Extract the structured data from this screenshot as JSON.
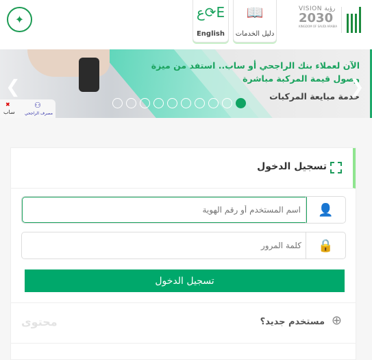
{
  "header": {
    "english_label": "English",
    "guide_label": "دليل الخدمات",
    "vision": {
      "line1": "VISION رؤية",
      "line2": "2030",
      "line3": "KINGDOM OF SAUDI ARABIA"
    },
    "logo": "أبشر"
  },
  "banner": {
    "line1": "الآن لعملاء بنك الراجحي أو ساب.. استفد من ميزة",
    "line2": "وصول قيمة المركبة مباشرة",
    "title": "خدمة مبايعة المركبات",
    "slide_count": 10,
    "active_slide": 1,
    "partners": [
      "ساب",
      "مصرف الراجحي"
    ]
  },
  "login": {
    "title": "تسجيل الدخول",
    "username_placeholder": "اسم المستخدم أو رقم الهوية",
    "password_placeholder": "كلمة المرور",
    "submit_label": "تسجيل الدخول",
    "new_user_label": "مستخدم جديد؟",
    "watermark": "محتوى"
  },
  "colors": {
    "accent": "#00a86b",
    "highlight": "#8fe58f"
  }
}
